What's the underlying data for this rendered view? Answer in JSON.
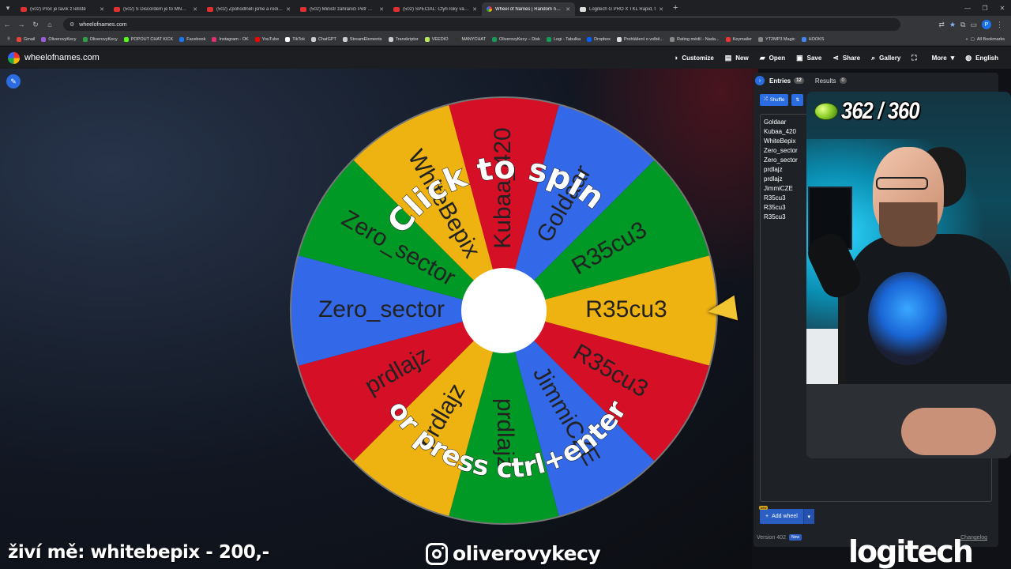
{
  "browser": {
    "tabs": [
      {
        "title": "(502) Proč je tavík z letiště",
        "icon": "youtube-icon"
      },
      {
        "title": "(502) S Discordem je to MNOHEM",
        "icon": "youtube-icon"
      },
      {
        "title": "(502) Zpohodlnělí jsme a rodiče",
        "icon": "youtube-icon"
      },
      {
        "title": "(502) Ministr zahraničí Petr Macinka",
        "icon": "youtube-icon"
      },
      {
        "title": "(502) SPECIÁL: Čtyři roky války",
        "icon": "youtube-icon"
      },
      {
        "title": "Wheel of Names | Random name",
        "icon": "wheel-icon",
        "active": true
      },
      {
        "title": "Logitech G PRO X TKL Rapid, t",
        "icon": "doc-icon"
      }
    ],
    "url": "wheelofnames.com",
    "bookmarks": [
      "Gmail",
      "OliverovyKecy",
      "OliverovyKecy",
      "POPOUT CHAT KICK",
      "Facebook",
      "Instagram - OK",
      "YouTube",
      "TikTok",
      "ChatGPT",
      "StreamElements",
      "Transkriptor",
      "VEEDIO",
      "MANYCHAT",
      "OliverovyKecy – Disk",
      "Logi - Tabulka",
      "Dropbox",
      "Prohlášení o volbě...",
      "Rating médií - Nada...",
      "Keymailer",
      "YT2MP3 Magic",
      "HOOKS"
    ],
    "all_bookmarks": "All Bookmarks",
    "profile_initial": "P"
  },
  "app": {
    "site_name": "wheelofnames.com",
    "menu": [
      {
        "label": "Customize",
        "icon": "palette-icon"
      },
      {
        "label": "New",
        "icon": "file-icon"
      },
      {
        "label": "Open",
        "icon": "folder-icon"
      },
      {
        "label": "Save",
        "icon": "save-icon"
      },
      {
        "label": "Share",
        "icon": "share-icon"
      },
      {
        "label": "Gallery",
        "icon": "search-icon"
      },
      {
        "label": "",
        "icon": "fullscreen-icon"
      },
      {
        "label": "More",
        "icon": "chevron-down-icon"
      },
      {
        "label": "English",
        "icon": "globe-icon"
      }
    ]
  },
  "wheel": {
    "prompt_line1": "Click to spin",
    "prompt_line2": "or press ctrl+enter",
    "segments": [
      {
        "label": "Goldaar",
        "color": "#3369e8"
      },
      {
        "label": "R35cu3",
        "color": "#009925"
      },
      {
        "label": "R35cu3",
        "color": "#eeb211"
      },
      {
        "label": "R35cu3",
        "color": "#d50f25"
      },
      {
        "label": "JimmiCZE",
        "color": "#3369e8"
      },
      {
        "label": "prdlajz",
        "color": "#009925"
      },
      {
        "label": "prdlajz",
        "color": "#eeb211"
      },
      {
        "label": "prdlajz",
        "color": "#d50f25"
      },
      {
        "label": "Zero_sector",
        "color": "#3369e8"
      },
      {
        "label": "Zero_sector",
        "color": "#009925"
      },
      {
        "label": "WhiteBepix",
        "color": "#eeb211"
      },
      {
        "label": "Kubaa_420",
        "color": "#d50f25"
      }
    ],
    "pointer_color": "#f1c532"
  },
  "sidebar": {
    "entries_tab": "Entries",
    "entries_count": "12",
    "results_tab": "Results",
    "results_count": "0",
    "shuffle_label": "Shuffle",
    "entries": [
      "Goldaar",
      "Kubaa_420",
      "WhiteBepix",
      "Zero_sector",
      "Zero_sector",
      "prdlajz",
      "prdlajz",
      "JimmiCZE",
      "R35cu3",
      "R35cu3",
      "R35cu3"
    ],
    "new_badge": "new",
    "add_wheel_label": "Add wheel",
    "version": "Version 402",
    "version_badge": "New",
    "changelog": "Changelog"
  },
  "overlay": {
    "counter": "362 / 360",
    "supporter": "živí mě: whitebepix - 200,-",
    "instagram": "oliverovykecy",
    "sponsor": "logitech"
  }
}
